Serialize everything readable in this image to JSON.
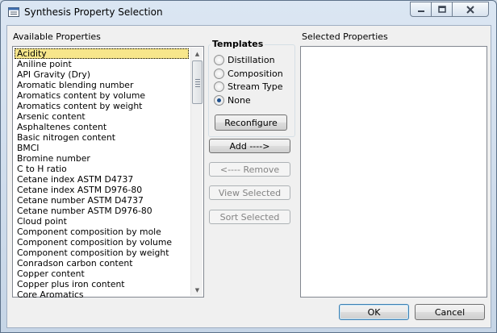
{
  "window": {
    "title": "Synthesis Property Selection"
  },
  "available": {
    "label": "Available Properties",
    "items": [
      "Acidity",
      "Aniline point",
      "API Gravity (Dry)",
      "Aromatic blending number",
      "Aromatics content by volume",
      "Aromatics content by weight",
      "Arsenic content",
      "Asphaltenes content",
      "Basic nitrogen content",
      "BMCI",
      "Bromine number",
      "C to H ratio",
      "Cetane index ASTM D4737",
      "Cetane index ASTM D976-80",
      "Cetane number ASTM D4737",
      "Cetane number ASTM D976-80",
      "Cloud point",
      "Component composition by mole",
      "Component composition by volume",
      "Component composition by weight",
      "Conradson carbon content",
      "Copper content",
      "Copper plus iron content",
      "Core Aromatics"
    ],
    "selected_index": 0
  },
  "templates": {
    "title": "Templates",
    "options": [
      "Distillation",
      "Composition",
      "Stream Type",
      "None"
    ],
    "checked": "None",
    "reconfigure_label": "Reconfigure"
  },
  "actions": {
    "add": "Add ---->",
    "remove": "<---- Remove",
    "view_selected": "View Selected",
    "sort_selected": "Sort Selected"
  },
  "selected": {
    "label": "Selected Properties",
    "items": []
  },
  "footer": {
    "ok": "OK",
    "cancel": "Cancel"
  }
}
